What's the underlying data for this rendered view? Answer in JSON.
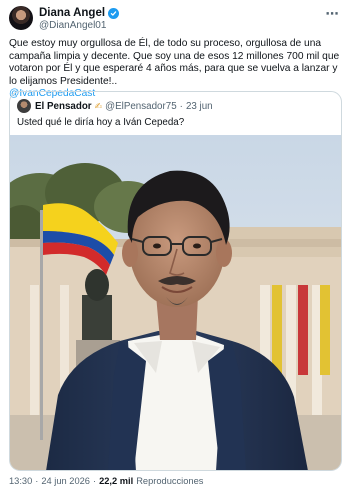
{
  "author": {
    "name": "Diana Angel",
    "handle": "@DianAngel01",
    "verified_color": "#1d9bf0"
  },
  "more_icon": "⋯",
  "tweet": {
    "text": "Que estoy muy orgullosa de Él, de todo su proceso, orgullosa de una campaña limpia y decente. Que soy una de esos 12 millones 700 mil que votaron por Él y que esperaré 4 años más, para que se vuelva a lanzar y lo elijamos Presidente!..",
    "mention": "@IvanCepedaCast"
  },
  "quoted": {
    "name": "El Pensador",
    "emoji": "✍",
    "handle": "@ElPensador75",
    "separator": "·",
    "date": "23 jun",
    "text": "Usted qué le diría hoy a Iván Cepeda?"
  },
  "footer": {
    "time": "13:30",
    "dot1": "·",
    "date": "24 jun 2026",
    "dot2": "·",
    "views_count": "22,2 mil",
    "views_label": "Reproducciones"
  },
  "colors": {
    "accent": "#1d9bf0",
    "text_primary": "#0f1419",
    "text_secondary": "#536471",
    "border": "#cfd9de"
  }
}
